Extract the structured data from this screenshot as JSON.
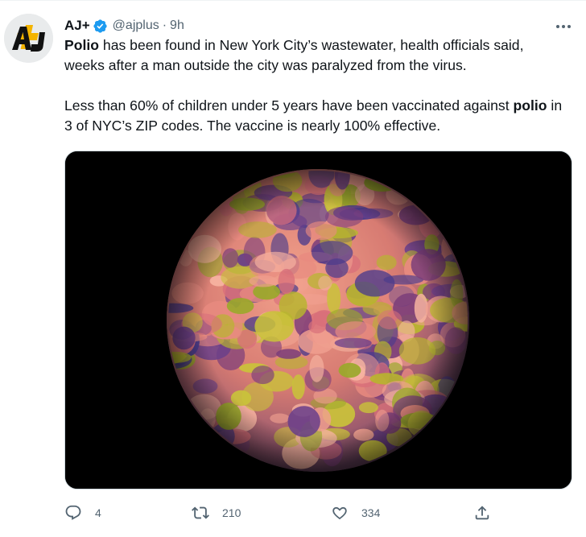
{
  "tweet": {
    "author_name": "AJ+",
    "handle": "@ajplus",
    "separator": "·",
    "time": "9h",
    "avatar_text": "AJ+",
    "paragraph1": [
      {
        "text": "Polio",
        "bold": true
      },
      {
        "text": " has been found in New York City’s wastewater, health officials said, weeks after a man outside the city was paralyzed from the virus.",
        "bold": false
      }
    ],
    "paragraph2": [
      {
        "text": "Less than 60% of children under 5 years have been vaccinated against ",
        "bold": false
      },
      {
        "text": "polio",
        "bold": true
      },
      {
        "text": " in 3 of NYC’s ZIP codes. The vaccine is nearly 100% effective.",
        "bold": false
      }
    ],
    "media_icon": "poliovirus-image"
  },
  "actions": {
    "reply_count": "4",
    "retweet_count": "210",
    "like_count": "334"
  },
  "icons": {
    "verified": "verified-badge-icon",
    "more": "more-icon",
    "reply": "reply-icon",
    "retweet": "retweet-icon",
    "like": "heart-icon",
    "share": "share-icon"
  },
  "colors": {
    "verified_blue": "#1d9bf0",
    "secondary_text": "#536471",
    "primary_text": "#0f1419",
    "logo_yellow": "#f4b400"
  }
}
